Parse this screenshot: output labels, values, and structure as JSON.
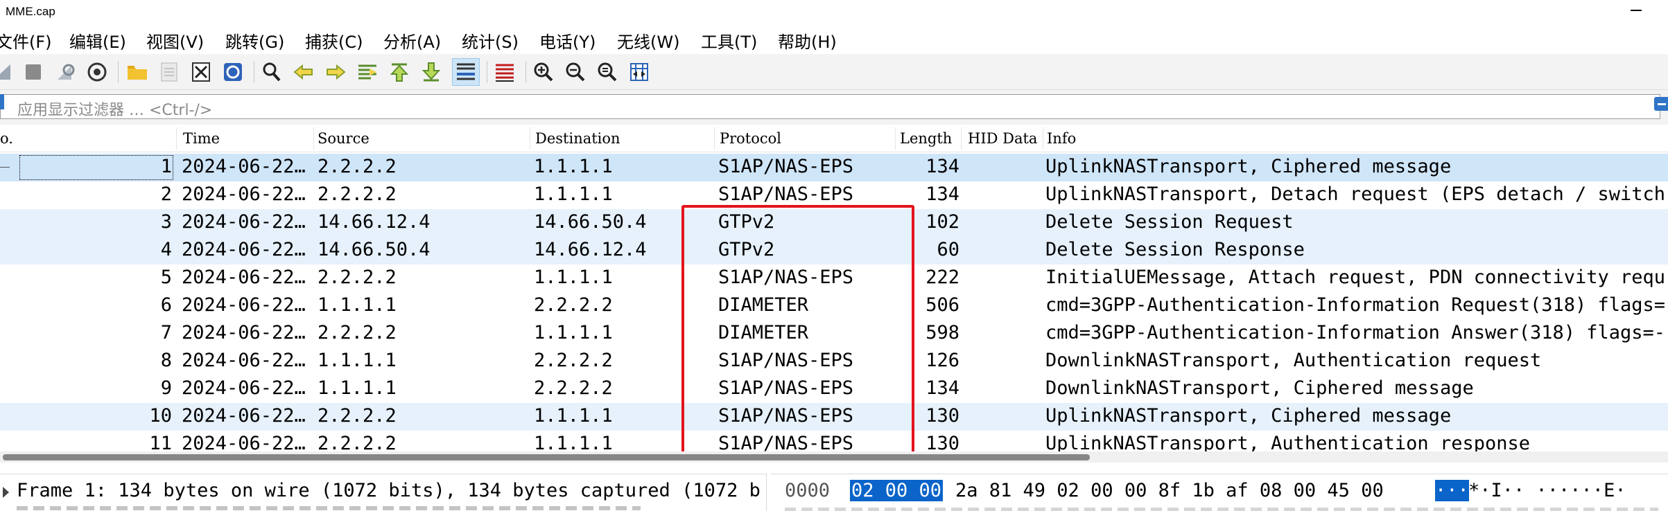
{
  "window": {
    "title": "MME.cap"
  },
  "menu": [
    "文件(F)",
    "编辑(E)",
    "视图(V)",
    "跳转(G)",
    "捕获(C)",
    "分析(A)",
    "统计(S)",
    "电话(Y)",
    "无线(W)",
    "工具(T)",
    "帮助(H)"
  ],
  "toolbar": {
    "icons": [
      "shark-fin-start-icon",
      "stop-capture-icon",
      "restart-capture-icon",
      "capture-options-icon",
      "open-file-icon",
      "save-file-icon",
      "close-file-icon",
      "reload-file-icon",
      "find-packet-icon",
      "go-back-icon",
      "go-forward-icon",
      "go-to-packet-icon",
      "go-first-packet-icon",
      "go-last-packet-icon",
      "auto-scroll-icon",
      "colorize-icon",
      "zoom-in-icon",
      "zoom-out-icon",
      "zoom-normal-icon",
      "resize-columns-icon"
    ]
  },
  "filter": {
    "placeholder": "应用显示过滤器 … <Ctrl-/>"
  },
  "packet_list": {
    "columns": {
      "no": "o.",
      "time": "Time",
      "source": "Source",
      "destination": "Destination",
      "protocol": "Protocol",
      "length": "Length",
      "hid": "HID Data",
      "info": "Info"
    },
    "rows": [
      {
        "no": "1",
        "time": "2024-06-22…",
        "source": "2.2.2.2",
        "destination": "1.1.1.1",
        "protocol": "S1AP/NAS-EPS",
        "length": "134",
        "hid": "",
        "info": "UplinkNASTransport, Ciphered message",
        "state": "selected"
      },
      {
        "no": "2",
        "time": "2024-06-22…",
        "source": "2.2.2.2",
        "destination": "1.1.1.1",
        "protocol": "S1AP/NAS-EPS",
        "length": "134",
        "hid": "",
        "info": "UplinkNASTransport, Detach request (EPS detach / switch",
        "state": "plain"
      },
      {
        "no": "3",
        "time": "2024-06-22…",
        "source": "14.66.12.4",
        "destination": "14.66.50.4",
        "protocol": "GTPv2",
        "length": "102",
        "hid": "",
        "info": "Delete Session Request",
        "state": "shaded"
      },
      {
        "no": "4",
        "time": "2024-06-22…",
        "source": "14.66.50.4",
        "destination": "14.66.12.4",
        "protocol": "GTPv2",
        "length": "60",
        "hid": "",
        "info": "Delete Session Response",
        "state": "shaded"
      },
      {
        "no": "5",
        "time": "2024-06-22…",
        "source": "2.2.2.2",
        "destination": "1.1.1.1",
        "protocol": "S1AP/NAS-EPS",
        "length": "222",
        "hid": "",
        "info": "InitialUEMessage, Attach request, PDN connectivity requ",
        "state": "plain"
      },
      {
        "no": "6",
        "time": "2024-06-22…",
        "source": "1.1.1.1",
        "destination": "2.2.2.2",
        "protocol": "DIAMETER",
        "length": "506",
        "hid": "",
        "info": "cmd=3GPP-Authentication-Information Request(318) flags=",
        "state": "plain"
      },
      {
        "no": "7",
        "time": "2024-06-22…",
        "source": "2.2.2.2",
        "destination": "1.1.1.1",
        "protocol": "DIAMETER",
        "length": "598",
        "hid": "",
        "info": "cmd=3GPP-Authentication-Information Answer(318) flags=-",
        "state": "plain"
      },
      {
        "no": "8",
        "time": "2024-06-22…",
        "source": "1.1.1.1",
        "destination": "2.2.2.2",
        "protocol": "S1AP/NAS-EPS",
        "length": "126",
        "hid": "",
        "info": "DownlinkNASTransport, Authentication request",
        "state": "plain"
      },
      {
        "no": "9",
        "time": "2024-06-22…",
        "source": "1.1.1.1",
        "destination": "2.2.2.2",
        "protocol": "S1AP/NAS-EPS",
        "length": "134",
        "hid": "",
        "info": "DownlinkNASTransport, Ciphered message",
        "state": "plain"
      },
      {
        "no": "10",
        "time": "2024-06-22…",
        "source": "2.2.2.2",
        "destination": "1.1.1.1",
        "protocol": "S1AP/NAS-EPS",
        "length": "130",
        "hid": "",
        "info": "UplinkNASTransport, Ciphered message",
        "state": "shaded"
      },
      {
        "no": "11",
        "time": "2024-06-22…",
        "source": "2.2.2.2",
        "destination": "1.1.1.1",
        "protocol": "S1AP/NAS-EPS",
        "length": "130",
        "hid": "",
        "info": "UplinkNASTransport, Authentication response",
        "state": "plain"
      }
    ]
  },
  "details": {
    "line1": "Frame 1: 134 bytes on wire (1072 bits), 134 bytes captured (1072 b"
  },
  "bytes": {
    "offset": "0000",
    "hex_selected": "02 00 00",
    "hex_rest": "2a 81 49 02 00  00 8f 1b af 08 00 45 00",
    "ascii_selected": "···",
    "ascii_rest": "*·I·· ······E·"
  },
  "colors": {
    "selected_row": "#cfe5f8",
    "shaded_row": "#e6f1fc",
    "highlight_box": "#e3141d",
    "byte_selection": "#0a64c9"
  }
}
